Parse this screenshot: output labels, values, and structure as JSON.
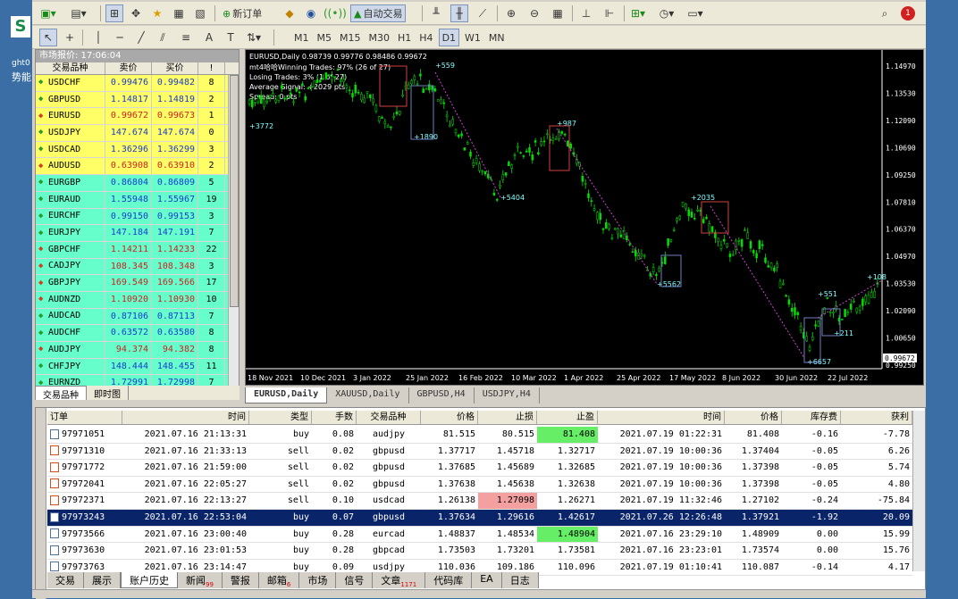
{
  "toolbar1": {
    "new_order": "新订单",
    "auto_trade": "自动交易"
  },
  "toolbar2": {
    "timeframes": [
      "M1",
      "M5",
      "M15",
      "M30",
      "H1",
      "H4",
      "D1",
      "W1",
      "MN"
    ],
    "active_timeframe": "D1"
  },
  "market_watch": {
    "title": "市场报价: 17:06:04",
    "headers": [
      "交易品种",
      "卖价",
      "买价",
      "!"
    ],
    "rows": [
      {
        "sym": "USDCHF",
        "bid": "0.99476",
        "ask": "0.99482",
        "spr": "8",
        "dir": "up",
        "color": "#ffff66"
      },
      {
        "sym": "GBPUSD",
        "bid": "1.14817",
        "ask": "1.14819",
        "spr": "2",
        "dir": "up",
        "color": "#ffff66"
      },
      {
        "sym": "EURUSD",
        "bid": "0.99672",
        "ask": "0.99673",
        "spr": "1",
        "dir": "down",
        "color": "#ffff66"
      },
      {
        "sym": "USDJPY",
        "bid": "147.674",
        "ask": "147.674",
        "spr": "0",
        "dir": "up",
        "color": "#ffff66"
      },
      {
        "sym": "USDCAD",
        "bid": "1.36296",
        "ask": "1.36299",
        "spr": "3",
        "dir": "up",
        "color": "#ffff66"
      },
      {
        "sym": "AUDUSD",
        "bid": "0.63908",
        "ask": "0.63910",
        "spr": "2",
        "dir": "down",
        "color": "#ffff66"
      },
      {
        "sym": "EURGBP",
        "bid": "0.86804",
        "ask": "0.86809",
        "spr": "5",
        "dir": "up",
        "color": "#66ffcc"
      },
      {
        "sym": "EURAUD",
        "bid": "1.55948",
        "ask": "1.55967",
        "spr": "19",
        "dir": "up",
        "color": "#66ffcc"
      },
      {
        "sym": "EURCHF",
        "bid": "0.99150",
        "ask": "0.99153",
        "spr": "3",
        "dir": "up",
        "color": "#66ffcc"
      },
      {
        "sym": "EURJPY",
        "bid": "147.184",
        "ask": "147.191",
        "spr": "7",
        "dir": "up",
        "color": "#66ffcc"
      },
      {
        "sym": "GBPCHF",
        "bid": "1.14211",
        "ask": "1.14233",
        "spr": "22",
        "dir": "down",
        "color": "#66ffcc"
      },
      {
        "sym": "CADJPY",
        "bid": "108.345",
        "ask": "108.348",
        "spr": "3",
        "dir": "down",
        "color": "#66ffcc"
      },
      {
        "sym": "GBPJPY",
        "bid": "169.549",
        "ask": "169.566",
        "spr": "17",
        "dir": "down",
        "color": "#66ffcc"
      },
      {
        "sym": "AUDNZD",
        "bid": "1.10920",
        "ask": "1.10930",
        "spr": "10",
        "dir": "down",
        "color": "#66ffcc"
      },
      {
        "sym": "AUDCAD",
        "bid": "0.87106",
        "ask": "0.87113",
        "spr": "7",
        "dir": "up",
        "color": "#66ffcc"
      },
      {
        "sym": "AUDCHF",
        "bid": "0.63572",
        "ask": "0.63580",
        "spr": "8",
        "dir": "up",
        "color": "#66ffcc"
      },
      {
        "sym": "AUDJPY",
        "bid": "94.374",
        "ask": "94.382",
        "spr": "8",
        "dir": "down",
        "color": "#66ffcc"
      },
      {
        "sym": "CHFJPY",
        "bid": "148.444",
        "ask": "148.455",
        "spr": "11",
        "dir": "up",
        "color": "#66ffcc"
      },
      {
        "sym": "EURNZD",
        "bid": "1.72991",
        "ask": "1.72998",
        "spr": "7",
        "dir": "up",
        "color": "#66ffcc"
      }
    ],
    "tabs": [
      "交易品种",
      "即时图"
    ]
  },
  "chart": {
    "info_line": "EURUSD,Daily  0.98739 0.99776 0.98486 0.99672",
    "overlay": [
      "mt4哈哈Winning Trades: 97% (26 of 27)",
      "Losing Trades: 3% (1 of 27)",
      "Average Signal: +2029 pts",
      "Spread: 0 pts"
    ],
    "price_labels": [
      "1.14970",
      "1.13530",
      "1.12090",
      "1.10690",
      "1.09250",
      "1.07810",
      "1.06370",
      "1.04970",
      "1.03530",
      "1.02090",
      "1.00650",
      "0.99250"
    ],
    "current_price": "0.99672",
    "date_labels": [
      "18 Nov 2021",
      "10 Dec 2021",
      "3 Jan 2022",
      "25 Jan 2022",
      "16 Feb 2022",
      "10 Mar 2022",
      "1 Apr 2022",
      "25 Apr 2022",
      "17 May 2022",
      "8 Jun 2022",
      "30 Jun 2022",
      "22 Jul 2022"
    ],
    "signals": [
      {
        "label": "+3772"
      },
      {
        "label": "+559"
      },
      {
        "label": "+1890"
      },
      {
        "label": "+5404"
      },
      {
        "label": "+987"
      },
      {
        "label": "+2035"
      },
      {
        "label": "+5562"
      },
      {
        "label": "+551"
      },
      {
        "label": "+211"
      },
      {
        "label": "+6657"
      },
      {
        "label": "+108"
      }
    ]
  },
  "chart_tabs": [
    "EURUSD,Daily",
    "XAUUSD,Daily",
    "GBPUSD,H4",
    "USDJPY,H4"
  ],
  "terminal": {
    "headers": [
      "订单",
      "时间",
      "类型",
      "手数",
      "交易品种",
      "价格",
      "止损",
      "止盈",
      "时间",
      "价格",
      "库存费",
      "获利"
    ],
    "rows": [
      {
        "order": "97971051",
        "open": "2021.07.16 21:13:31",
        "type": "buy",
        "lots": "0.08",
        "sym": "audjpy",
        "price": "81.515",
        "sl": "80.515",
        "tp": "81.408",
        "close": "2021.07.19 01:22:31",
        "cprice": "81.408",
        "swap": "-0.16",
        "profit": "-7.78",
        "tp_hl": true,
        "sl_hl": false,
        "sel": false
      },
      {
        "order": "97971310",
        "open": "2021.07.16 21:33:13",
        "type": "sell",
        "lots": "0.02",
        "sym": "gbpusd",
        "price": "1.37717",
        "sl": "1.45718",
        "tp": "1.32717",
        "close": "2021.07.19 10:00:36",
        "cprice": "1.37404",
        "swap": "-0.05",
        "profit": "6.26",
        "tp_hl": false,
        "sl_hl": false,
        "sel": false
      },
      {
        "order": "97971772",
        "open": "2021.07.16 21:59:00",
        "type": "sell",
        "lots": "0.02",
        "sym": "gbpusd",
        "price": "1.37685",
        "sl": "1.45689",
        "tp": "1.32685",
        "close": "2021.07.19 10:00:36",
        "cprice": "1.37398",
        "swap": "-0.05",
        "profit": "5.74",
        "tp_hl": false,
        "sl_hl": false,
        "sel": false
      },
      {
        "order": "97972041",
        "open": "2021.07.16 22:05:27",
        "type": "sell",
        "lots": "0.02",
        "sym": "gbpusd",
        "price": "1.37638",
        "sl": "1.45638",
        "tp": "1.32638",
        "close": "2021.07.19 10:00:36",
        "cprice": "1.37398",
        "swap": "-0.05",
        "profit": "4.80",
        "tp_hl": false,
        "sl_hl": false,
        "sel": false
      },
      {
        "order": "97972371",
        "open": "2021.07.16 22:13:27",
        "type": "sell",
        "lots": "0.10",
        "sym": "usdcad",
        "price": "1.26138",
        "sl": "1.27098",
        "tp": "1.26271",
        "close": "2021.07.19 11:32:46",
        "cprice": "1.27102",
        "swap": "-0.24",
        "profit": "-75.84",
        "tp_hl": false,
        "sl_hl": true,
        "sel": false
      },
      {
        "order": "97973243",
        "open": "2021.07.16 22:53:04",
        "type": "buy",
        "lots": "0.07",
        "sym": "gbpusd",
        "price": "1.37634",
        "sl": "1.29616",
        "tp": "1.42617",
        "close": "2021.07.26 12:26:48",
        "cprice": "1.37921",
        "swap": "-1.92",
        "profit": "20.09",
        "tp_hl": false,
        "sl_hl": false,
        "sel": true
      },
      {
        "order": "97973566",
        "open": "2021.07.16 23:00:40",
        "type": "buy",
        "lots": "0.28",
        "sym": "eurcad",
        "price": "1.48837",
        "sl": "1.48534",
        "tp": "1.48904",
        "close": "2021.07.16 23:29:10",
        "cprice": "1.48909",
        "swap": "0.00",
        "profit": "15.99",
        "tp_hl": true,
        "sl_hl": false,
        "sel": false
      },
      {
        "order": "97973630",
        "open": "2021.07.16 23:01:53",
        "type": "buy",
        "lots": "0.28",
        "sym": "gbpcad",
        "price": "1.73503",
        "sl": "1.73201",
        "tp": "1.73581",
        "close": "2021.07.16 23:23:01",
        "cprice": "1.73574",
        "swap": "0.00",
        "profit": "15.76",
        "tp_hl": false,
        "sl_hl": false,
        "sel": false
      },
      {
        "order": "97973763",
        "open": "2021.07.16 23:14:47",
        "type": "buy",
        "lots": "0.09",
        "sym": "usdjpy",
        "price": "110.036",
        "sl": "109.186",
        "tp": "110.096",
        "close": "2021.07.19 01:10:41",
        "cprice": "110.087",
        "swap": "-0.14",
        "profit": "4.17",
        "tp_hl": false,
        "sl_hl": false,
        "sel": false
      }
    ],
    "tabs": [
      {
        "label": "交易",
        "badge": ""
      },
      {
        "label": "展示",
        "badge": ""
      },
      {
        "label": "账户历史",
        "badge": ""
      },
      {
        "label": "新闻",
        "badge": "99"
      },
      {
        "label": "警报",
        "badge": ""
      },
      {
        "label": "邮箱",
        "badge": "6"
      },
      {
        "label": "市场",
        "badge": ""
      },
      {
        "label": "信号",
        "badge": ""
      },
      {
        "label": "文章",
        "badge": "1171"
      },
      {
        "label": "代码库",
        "badge": ""
      },
      {
        "label": "EA",
        "badge": ""
      },
      {
        "label": "日志",
        "badge": ""
      }
    ],
    "active_tab": "账户历史"
  },
  "side_text": {
    "brand": "S",
    "line1": "ght0",
    "line2": "势能"
  }
}
